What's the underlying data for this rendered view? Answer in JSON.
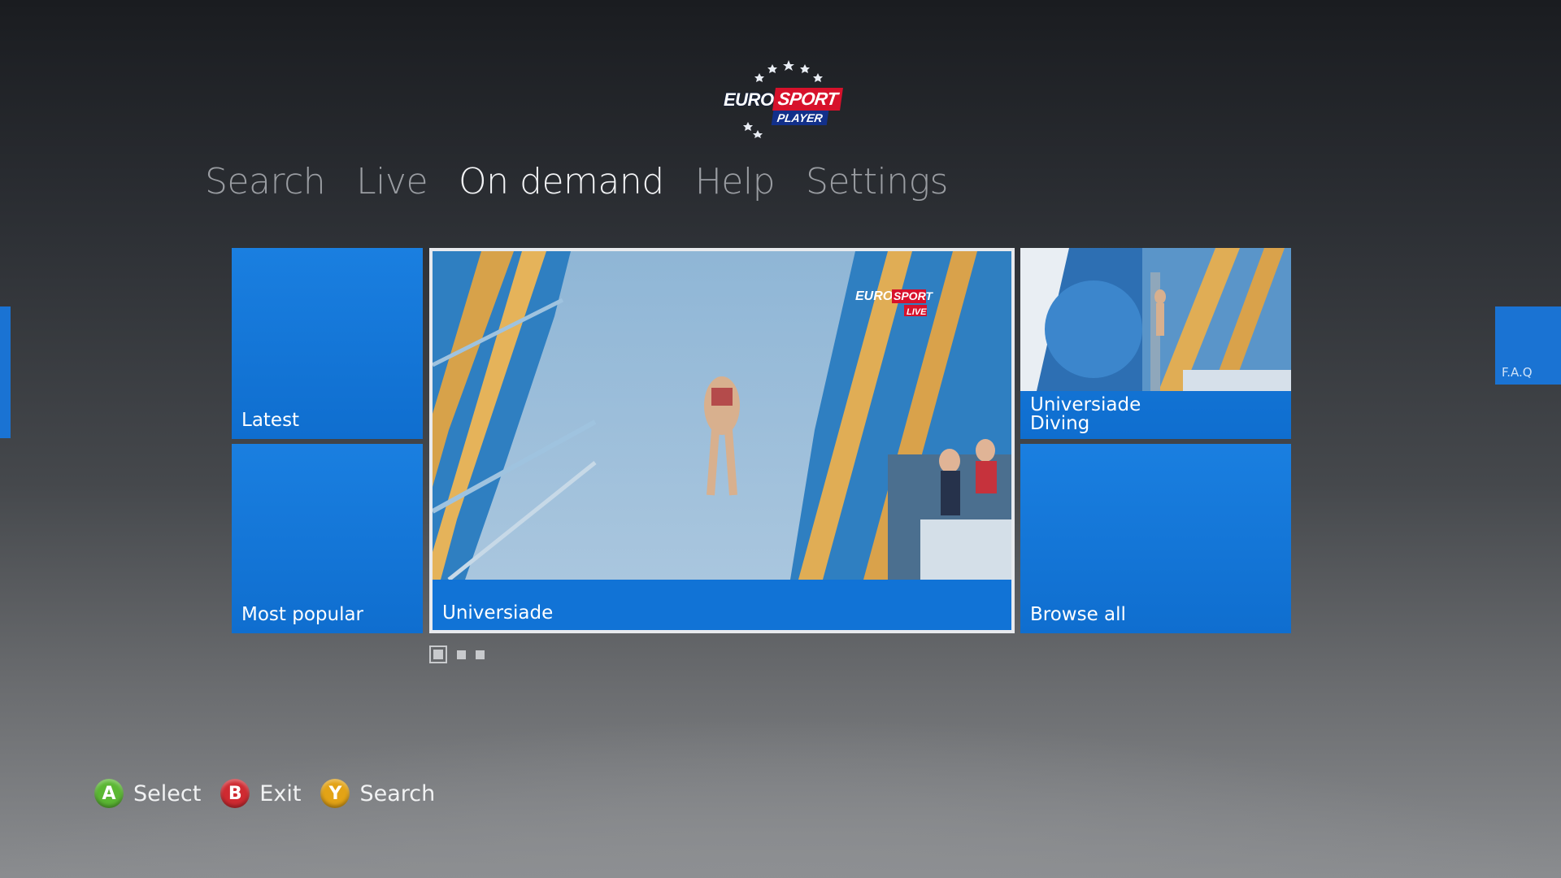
{
  "logo": {
    "euro": "EURO",
    "sport": "SPORT",
    "player": "PLAYER"
  },
  "nav": {
    "items": [
      {
        "label": "Search"
      },
      {
        "label": "Live"
      },
      {
        "label": "On demand",
        "active": true
      },
      {
        "label": "Help"
      },
      {
        "label": "Settings"
      }
    ]
  },
  "tiles": {
    "latest": "Latest",
    "most_popular": "Most popular",
    "featured": "Universiade",
    "diving_line1": "Universiade",
    "diving_line2": "Diving",
    "browse_all": "Browse all"
  },
  "side": {
    "faq": "F.A.Q"
  },
  "pager": {
    "pages": 3,
    "current": 1
  },
  "hints": [
    {
      "button": "A",
      "label": "Select",
      "color": "#5bb733"
    },
    {
      "button": "B",
      "label": "Exit",
      "color": "#cf2a31"
    },
    {
      "button": "Y",
      "label": "Search",
      "color": "#e3a316"
    }
  ],
  "colors": {
    "tile_blue": "#1173d6",
    "active_nav": "#f2f3f5",
    "inactive_nav": "#9a9da2"
  }
}
